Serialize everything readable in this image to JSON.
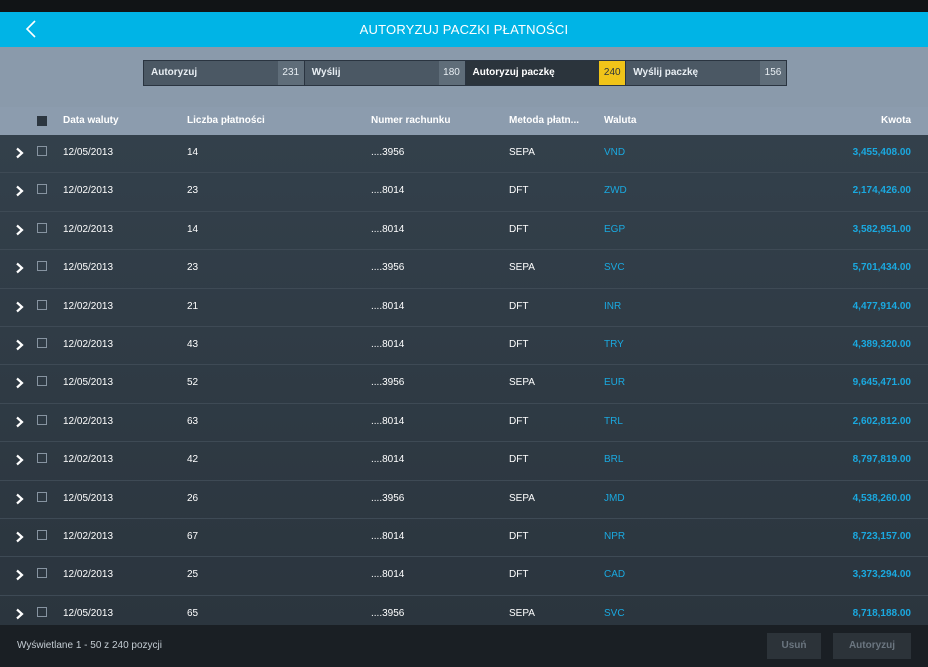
{
  "header": {
    "title": "AUTORYZUJ PACZKI PŁATNOŚCI"
  },
  "tabs": [
    {
      "label": "Autoryzuj",
      "count": "231",
      "active": false
    },
    {
      "label": "Wyślij",
      "count": "180",
      "active": false
    },
    {
      "label": "Autoryzuj paczkę",
      "count": "240",
      "active": true
    },
    {
      "label": "Wyślij paczkę",
      "count": "156",
      "active": false
    }
  ],
  "columns": {
    "date": "Data waluty",
    "count": "Liczba płatności",
    "account": "Numer rachunku",
    "method": "Metoda płatn...",
    "currency": "Waluta",
    "amount": "Kwota"
  },
  "rows": [
    {
      "date": "12/05/2013",
      "count": "14",
      "account": "....3956",
      "method": "SEPA",
      "currency": "VND",
      "amount": "3,455,408.00"
    },
    {
      "date": "12/02/2013",
      "count": "23",
      "account": "....8014",
      "method": "DFT",
      "currency": "ZWD",
      "amount": "2,174,426.00"
    },
    {
      "date": "12/02/2013",
      "count": "14",
      "account": "....8014",
      "method": "DFT",
      "currency": "EGP",
      "amount": "3,582,951.00"
    },
    {
      "date": "12/05/2013",
      "count": "23",
      "account": "....3956",
      "method": "SEPA",
      "currency": "SVC",
      "amount": "5,701,434.00"
    },
    {
      "date": "12/02/2013",
      "count": "21",
      "account": "....8014",
      "method": "DFT",
      "currency": "INR",
      "amount": "4,477,914.00"
    },
    {
      "date": "12/02/2013",
      "count": "43",
      "account": "....8014",
      "method": "DFT",
      "currency": "TRY",
      "amount": "4,389,320.00"
    },
    {
      "date": "12/05/2013",
      "count": "52",
      "account": "....3956",
      "method": "SEPA",
      "currency": "EUR",
      "amount": "9,645,471.00"
    },
    {
      "date": "12/02/2013",
      "count": "63",
      "account": "....8014",
      "method": "DFT",
      "currency": "TRL",
      "amount": "2,602,812.00"
    },
    {
      "date": "12/02/2013",
      "count": "42",
      "account": "....8014",
      "method": "DFT",
      "currency": "BRL",
      "amount": "8,797,819.00"
    },
    {
      "date": "12/05/2013",
      "count": "26",
      "account": "....3956",
      "method": "SEPA",
      "currency": "JMD",
      "amount": "4,538,260.00"
    },
    {
      "date": "12/02/2013",
      "count": "67",
      "account": "....8014",
      "method": "DFT",
      "currency": "NPR",
      "amount": "8,723,157.00"
    },
    {
      "date": "12/02/2013",
      "count": "25",
      "account": "....8014",
      "method": "DFT",
      "currency": "CAD",
      "amount": "3,373,294.00"
    },
    {
      "date": "12/05/2013",
      "count": "65",
      "account": "....3956",
      "method": "SEPA",
      "currency": "SVC",
      "amount": "8,718,188.00"
    }
  ],
  "footer": {
    "status": "Wyświetlane 1 - 50 z 240 pozycji",
    "delete_label": "Usuń",
    "authorize_label": "Autoryzuj"
  },
  "colors": {
    "accent": "#00b4e6",
    "active_badge": "#f0c419",
    "link": "#1aa9e0"
  },
  "icons": {
    "back": "chevron-left-icon",
    "expand": "chevron-right-icon"
  }
}
